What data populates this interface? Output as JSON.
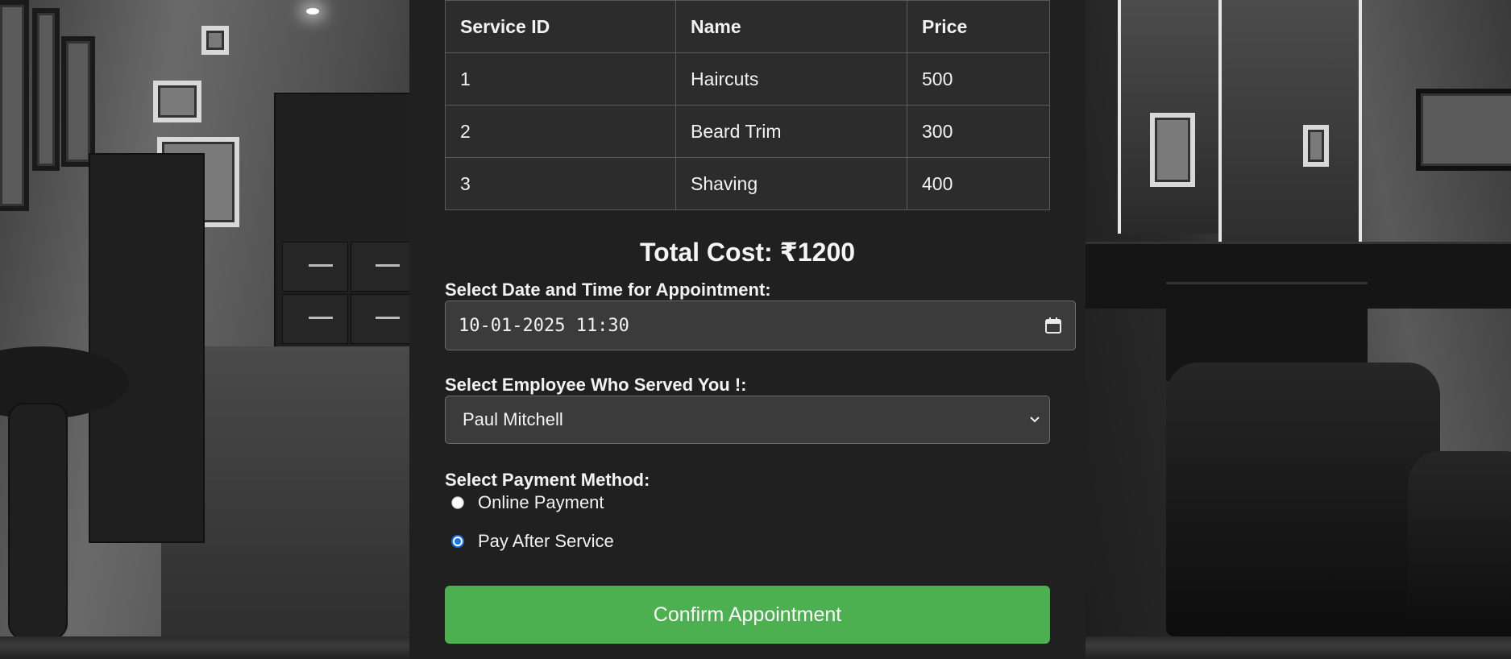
{
  "services_table": {
    "headers": [
      "Service ID",
      "Name",
      "Price"
    ],
    "rows": [
      [
        "1",
        "Haircuts",
        "500"
      ],
      [
        "2",
        "Beard Trim",
        "300"
      ],
      [
        "3",
        "Shaving",
        "400"
      ]
    ]
  },
  "total_cost": "Total Cost: ₹1200",
  "appointment": {
    "label": "Select Date and Time for Appointment:",
    "value": "10-01-2025 11:30",
    "icon": "calendar-icon"
  },
  "employee": {
    "label": "Select Employee Who Served You !:",
    "selected": "Paul Mitchell",
    "icon": "chevron-down-icon"
  },
  "payment": {
    "label": "Select Payment Method:",
    "options": [
      {
        "label": "Online Payment",
        "checked": false
      },
      {
        "label": "Pay After Service",
        "checked": true
      }
    ]
  },
  "confirm_label": "Confirm Appointment",
  "colors": {
    "panel": "#202020",
    "table_cell": "#2c2c2c",
    "input_bg": "#3b3b3b",
    "confirm": "#4caf50",
    "radio_checked": "#1a73e8"
  }
}
